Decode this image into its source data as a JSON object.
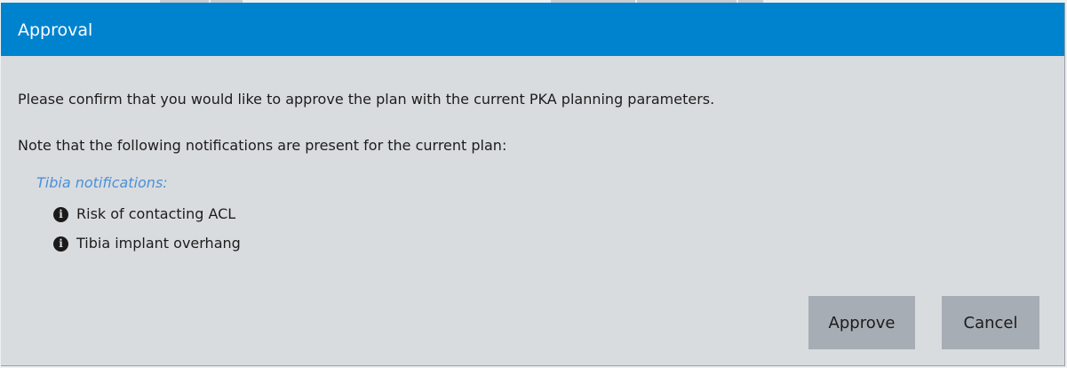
{
  "dialog": {
    "title": "Approval",
    "confirm_text": "Please confirm that you would like to approve the plan with the current PKA planning parameters.",
    "note_text": "Note that the following notifications are present for the current plan:",
    "notification_groups": [
      {
        "label": "Tibia notifications:",
        "items": [
          {
            "icon": "info-icon",
            "text": "Risk of contacting ACL"
          },
          {
            "icon": "info-icon",
            "text": "Tibia implant overhang"
          }
        ]
      }
    ],
    "buttons": {
      "approve_label": "Approve",
      "cancel_label": "Cancel"
    }
  },
  "colors": {
    "titlebar": "#0083cf",
    "dialog_bg": "#d9dcdf",
    "section_label": "#4a90d9",
    "button_bg": "#a6adb4"
  }
}
